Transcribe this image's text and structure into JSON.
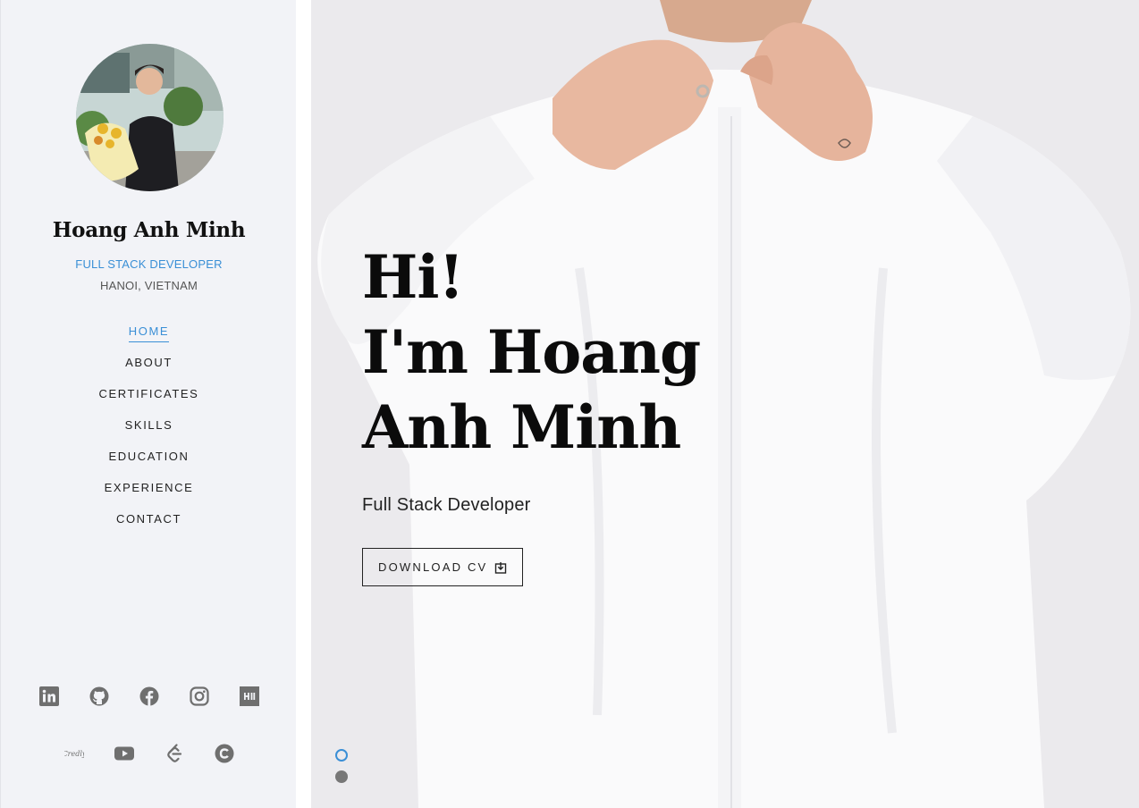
{
  "profile": {
    "name": "Hoang Anh Minh",
    "role": "FULL STACK DEVELOPER",
    "location": "HANOI, VIETNAM"
  },
  "nav": {
    "items": [
      {
        "label": "HOME",
        "active": true
      },
      {
        "label": "ABOUT",
        "active": false
      },
      {
        "label": "CERTIFICATES",
        "active": false
      },
      {
        "label": "SKILLS",
        "active": false
      },
      {
        "label": "EDUCATION",
        "active": false
      },
      {
        "label": "EXPERIENCE",
        "active": false
      },
      {
        "label": "CONTACT",
        "active": false
      }
    ]
  },
  "social": {
    "row1": [
      "linkedin-icon",
      "github-icon",
      "facebook-icon",
      "instagram-icon",
      "hashnode-icon"
    ],
    "row2": [
      "credly-icon",
      "youtube-icon",
      "leetcode-icon",
      "codecademy-icon"
    ],
    "credly_text": "Credly"
  },
  "hero": {
    "title_line1": "Hi!",
    "title_line2": "I'm Hoang",
    "title_line3": "Anh Minh",
    "subtitle": "Full Stack Developer",
    "cv_button": "DOWNLOAD CV",
    "slides_active_index": 0,
    "slides_count": 2
  },
  "colors": {
    "accent": "#3a8fd6",
    "sidebar_bg": "#f2f3f7",
    "text_dark": "#111111"
  }
}
